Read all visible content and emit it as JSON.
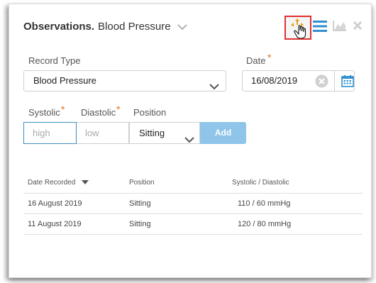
{
  "header": {
    "title_strong": "Observations.",
    "title_rest": "Blood Pressure"
  },
  "toolbar": {
    "icons": [
      "move-icon",
      "menu-icon",
      "chart-icon",
      "close-icon"
    ],
    "highlight_color": "#e03030",
    "accent_color": "#2f8fd0"
  },
  "form": {
    "record_type_label": "Record Type",
    "record_type_value": "Blood Pressure",
    "date_label": "Date",
    "date_value": "16/08/2019",
    "systolic_label": "Systolic",
    "diastolic_label": "Diastolic",
    "position_label": "Position",
    "systolic_placeholder": "high",
    "diastolic_placeholder": "low",
    "position_value": "Sitting",
    "add_label": "Add",
    "required_mark": "*"
  },
  "table": {
    "headers": [
      "Date Recorded",
      "Position",
      "Systolic / Diastolic"
    ],
    "rows": [
      {
        "date": "16 August 2019",
        "position": "Sitting",
        "bp": "110 / 60 mmHg"
      },
      {
        "date": "11 August 2019",
        "position": "Sitting",
        "bp": "120 / 80 mmHg"
      }
    ]
  }
}
